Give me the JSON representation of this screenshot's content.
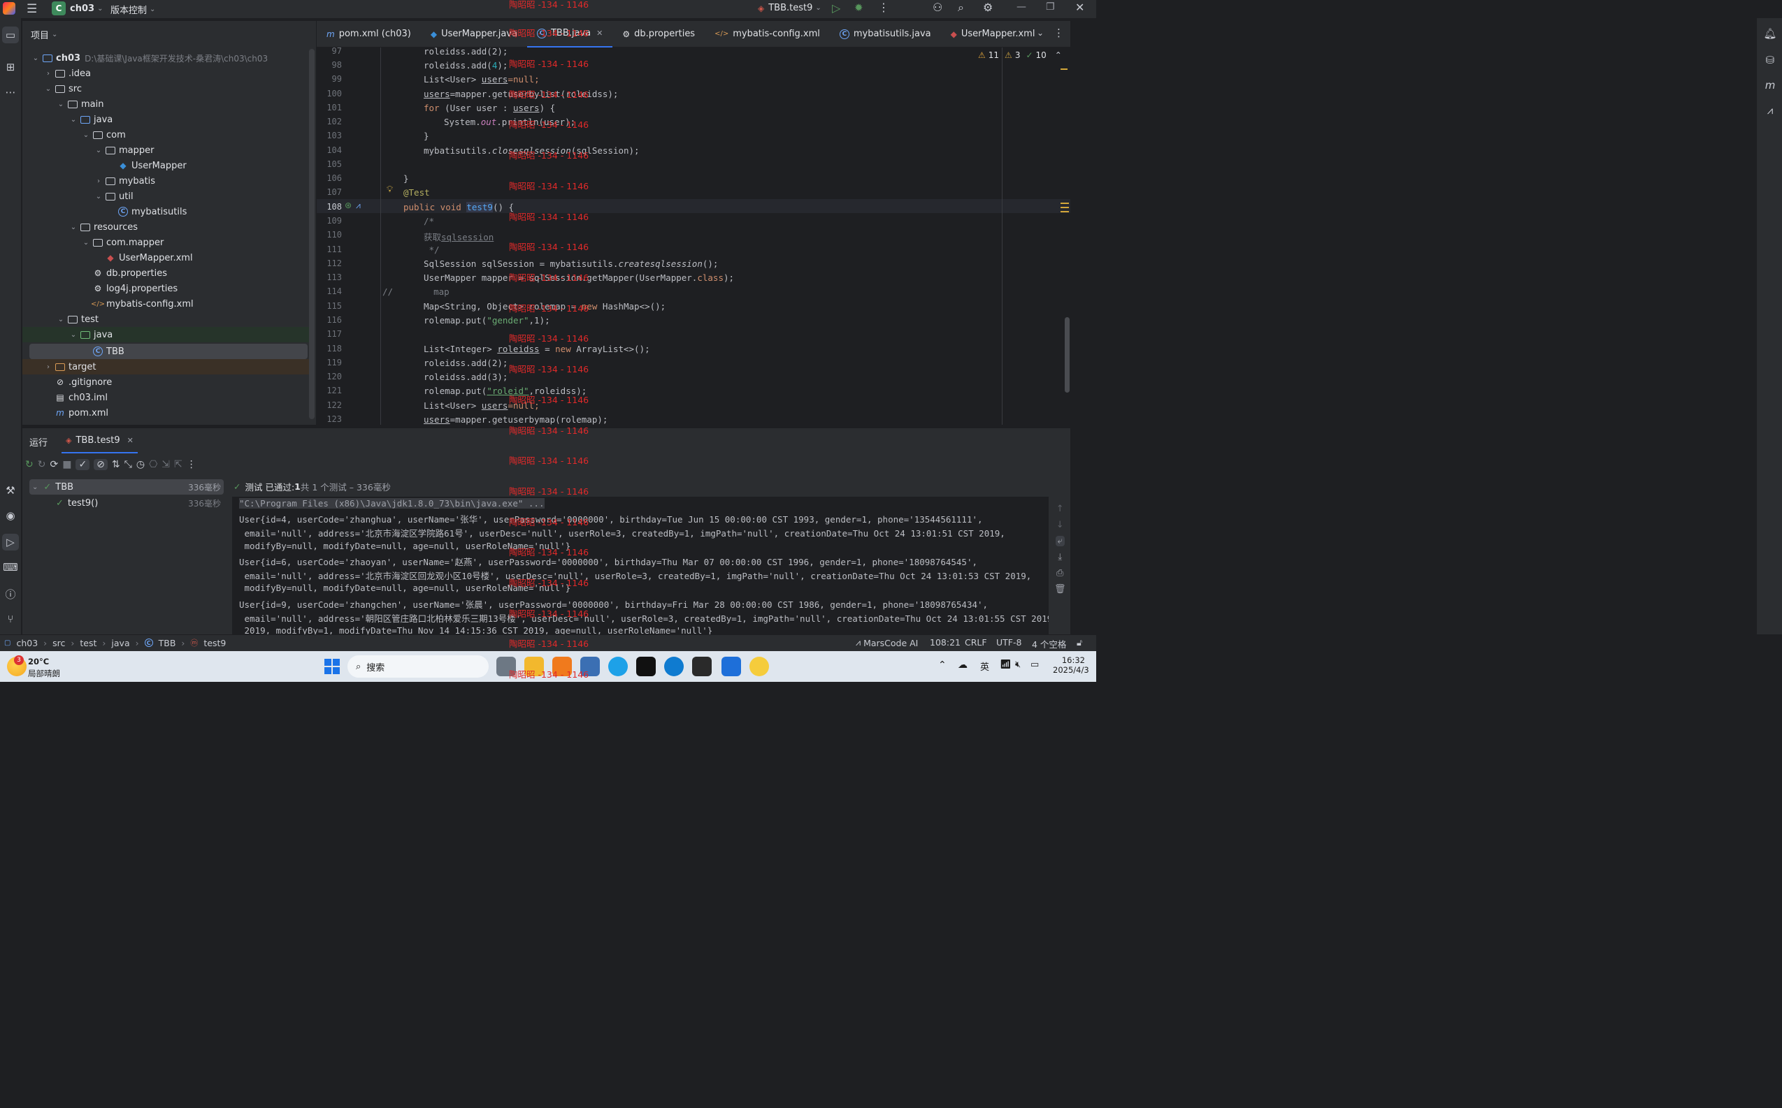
{
  "titlebar": {
    "project_letter": "C",
    "project_name": "ch03",
    "vcs_label": "版本控制",
    "run_config": "TBB.test9"
  },
  "project_panel": {
    "title": "项目",
    "tree": [
      {
        "label": "ch03",
        "hint": "D:\\基础课\\Java框架开发技术-桑君涛\\ch03\\ch03"
      },
      {
        "label": ".idea"
      },
      {
        "label": "src"
      },
      {
        "label": "main"
      },
      {
        "label": "java"
      },
      {
        "label": "com"
      },
      {
        "label": "mapper"
      },
      {
        "label": "UserMapper"
      },
      {
        "label": "mybatis"
      },
      {
        "label": "util"
      },
      {
        "label": "mybatisutils"
      },
      {
        "label": "resources"
      },
      {
        "label": "com.mapper"
      },
      {
        "label": "UserMapper.xml"
      },
      {
        "label": "db.properties"
      },
      {
        "label": "log4j.properties"
      },
      {
        "label": "mybatis-config.xml"
      },
      {
        "label": "test"
      },
      {
        "label": "java"
      },
      {
        "label": "TBB"
      },
      {
        "label": "target"
      },
      {
        "label": ".gitignore"
      },
      {
        "label": "ch03.iml"
      },
      {
        "label": "pom.xml"
      }
    ]
  },
  "editor_tabs": [
    {
      "label": "pom.xml (ch03)"
    },
    {
      "label": "UserMapper.java"
    },
    {
      "label": "TBB.java"
    },
    {
      "label": "db.properties"
    },
    {
      "label": "mybatis-config.xml"
    },
    {
      "label": "mybatisutils.java"
    },
    {
      "label": "UserMapper.xml"
    }
  ],
  "inspections": {
    "warnings": "11",
    "weak": "3",
    "ok": "10"
  },
  "line_numbers": [
    "97",
    "98",
    "99",
    "100",
    "101",
    "102",
    "103",
    "104",
    "105",
    "106",
    "107",
    "108",
    "109",
    "110",
    "111",
    "112",
    "113",
    "114",
    "115",
    "116",
    "117",
    "118",
    "119",
    "120",
    "121",
    "122",
    "123"
  ],
  "code": {
    "l97": "roleidss.add(2);",
    "l98": "roleidss.add(4);",
    "l99_a": "List<User> ",
    "l99_b": "users",
    "l99_c": "=null;",
    "l100_a": "users",
    "l100_b": "=mapper.getuserbylist(roleidss);",
    "l101_a": "for",
    "l101_b": " (User user : ",
    "l101_c": "users",
    "l101_d": ") {",
    "l102_a": "System.",
    "l102_b": "out",
    "l102_c": ".println(user);",
    "l103": "}",
    "l104_a": "mybatisutils.",
    "l104_b": "closesqlsession",
    "l104_c": "(sqlSession);",
    "l106": "}",
    "l107": "@Test",
    "l108_a": "public void ",
    "l108_b": "test9",
    "l108_c": "() {",
    "l109": "/*",
    "l110_a": "获取",
    "l110_b": "sqlsession",
    "l111": " */",
    "l112_a": "SqlSession sqlSession = mybatisutils.",
    "l112_b": "createsqlsession",
    "l112_c": "();",
    "l113_a": "UserMapper mapper = sqlSession.getMapper(UserMapper.",
    "l113_b": "class",
    "l113_c": ");",
    "l114_a": "//",
    "l114_b": "map",
    "l115_a": "Map<String, Object> rolemap = ",
    "l115_b": "new",
    "l115_c": " HashMap<>();",
    "l116_a": "rolemap.put(",
    "l116_b": "\"gender\"",
    "l116_c": ",1);",
    "l118_a": "List<Integer> ",
    "l118_b": "roleidss",
    "l118_c": " = ",
    "l118_d": "new",
    "l118_e": " ArrayList<>();",
    "l119": "roleidss.add(2);",
    "l120": "roleidss.add(3);",
    "l121_a": "rolemap.put(",
    "l121_b": "\"roleid\"",
    "l121_c": ",roleidss);",
    "l122_a": "List<User> ",
    "l122_b": "users",
    "l122_c": "=null;",
    "l123_a": "users",
    "l123_b": "=mapper.getuserbymap(rolemap);"
  },
  "run_panel": {
    "tab_run": "运行",
    "tab_config": "TBB.test9",
    "tree": [
      {
        "label": "TBB",
        "time": "336毫秒"
      },
      {
        "label": "test9()",
        "time": "336毫秒"
      }
    ],
    "summary_a": "测试 已通过: ",
    "summary_b": "1",
    "summary_c": "共 1 个测试 – 336毫秒",
    "console": [
      "\"C:\\Program Files (x86)\\Java\\jdk1.8.0_73\\bin\\java.exe\" ...",
      "User{id=4, userCode='zhanghua', userName='张华', userPassword='0000000', birthday=Tue Jun 15 00:00:00 CST 1993, gender=1, phone='13544561111',",
      " email='null', address='北京市海淀区学院路61号', userDesc='null', userRole=3, createdBy=1, imgPath='null', creationDate=Thu Oct 24 13:01:51 CST 2019,",
      " modifyBy=null, modifyDate=null, age=null, userRoleName='null'}",
      "User{id=6, userCode='zhaoyan', userName='赵燕', userPassword='0000000', birthday=Thu Mar 07 00:00:00 CST 1996, gender=1, phone='18098764545',",
      " email='null', address='北京市海淀区回龙观小区10号楼', userDesc='null', userRole=3, createdBy=1, imgPath='null', creationDate=Thu Oct 24 13:01:53 CST 2019,",
      " modifyBy=null, modifyDate=null, age=null, userRoleName='null'}",
      "User{id=9, userCode='zhangchen', userName='张晨', userPassword='0000000', birthday=Fri Mar 28 00:00:00 CST 1986, gender=1, phone='18098765434',",
      " email='null', address='朝阳区管庄路口北柏林爱乐三期13号楼', userDesc='null', userRole=3, createdBy=1, imgPath='null', creationDate=Thu Oct 24 13:01:55 CST 2019,",
      " 2019, modifyBy=1, modifyDate=Thu Nov 14 14:15:36 CST 2019, age=null, userRoleName='null'}"
    ]
  },
  "statusbar": {
    "breadcrumbs": [
      "ch03",
      "src",
      "test",
      "java",
      "TBB",
      "test9"
    ],
    "ai": "MarsCode AI",
    "position": "108:21",
    "line_sep": "CRLF",
    "encoding": "UTF-8",
    "indent": "4 个空格"
  },
  "taskbar": {
    "weather_badge": "3",
    "temp": "20°C",
    "weather": "局部晴朗",
    "search": "搜索",
    "ime": "英",
    "time": "16:32",
    "date": "2025/4/3"
  },
  "watermark": "陶昭昭 -134 - 1146",
  "colors": {
    "accent": "#3574f0",
    "watermark": "#e02a2a",
    "success": "#57965c"
  }
}
